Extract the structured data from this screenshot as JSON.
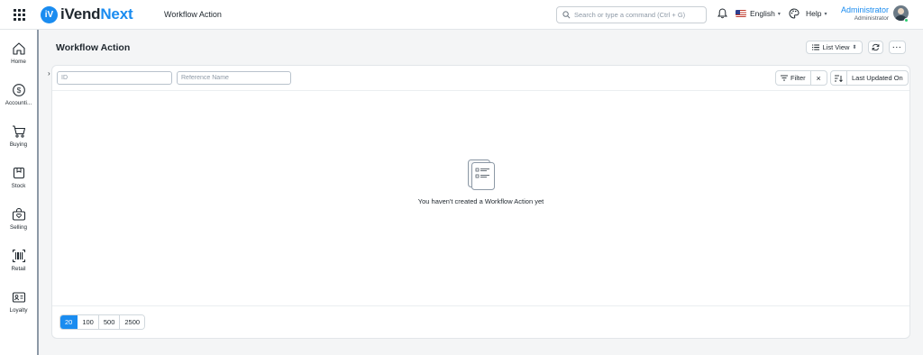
{
  "brand": {
    "logo_mark": "iV",
    "name_prefix": "iVend",
    "name_suffix": "Next"
  },
  "topbar": {
    "title": "Workflow Action",
    "search_placeholder": "Search or type a command (Ctrl + G)",
    "language": "English",
    "help": "Help",
    "user_name": "Administrator",
    "user_role": "Administrator"
  },
  "sidebar": {
    "items": [
      {
        "label": "Home",
        "icon": "home-icon"
      },
      {
        "label": "Accounti...",
        "icon": "dollar-icon"
      },
      {
        "label": "Buying",
        "icon": "cart-icon"
      },
      {
        "label": "Stock",
        "icon": "box-icon"
      },
      {
        "label": "Selling",
        "icon": "bag-icon"
      },
      {
        "label": "Retail",
        "icon": "barcode-icon"
      },
      {
        "label": "Loyalty",
        "icon": "id-card-icon"
      }
    ]
  },
  "page": {
    "title": "Workflow Action",
    "list_view_label": "List View",
    "more_label": "···"
  },
  "filters": {
    "id_placeholder": "ID",
    "reference_placeholder": "Reference Name",
    "filter_label": "Filter",
    "sort_label": "Last Updated On"
  },
  "empty_state": {
    "message": "You haven't created a Workflow Action yet"
  },
  "pagination": {
    "page_sizes": [
      "20",
      "100",
      "500",
      "2500"
    ],
    "selected": "20"
  },
  "colors": {
    "accent": "#1a8cf0",
    "online": "#2ecc71"
  }
}
